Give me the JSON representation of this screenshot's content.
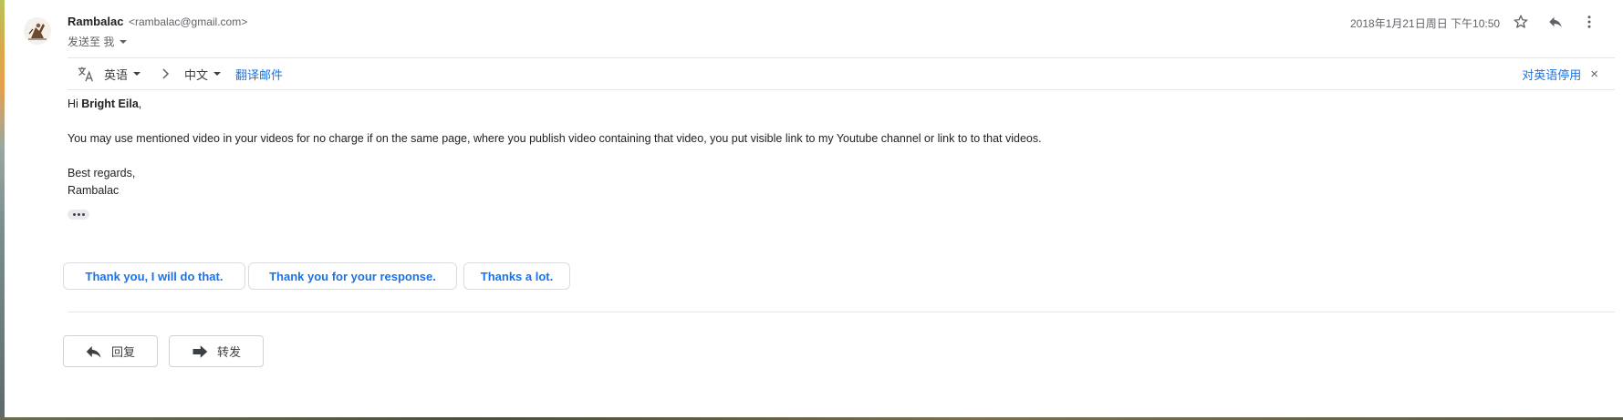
{
  "message": {
    "sender_name": "Rambalac",
    "sender_email": "<rambalac@gmail.com>",
    "to_label": "发送至 我",
    "date": "2018年1月21日周日 下午10:50"
  },
  "icons": {
    "star": "star-outline-icon",
    "reply": "reply-icon",
    "more": "more-vert-icon",
    "translate": "translate-icon",
    "chevron": "chevron-right-icon",
    "close": "close-icon",
    "forward": "forward-icon"
  },
  "translate_bar": {
    "source_lang": "英语",
    "target_lang": "中文",
    "translate_link": "翻译邮件",
    "disable_link": "对英语停用",
    "close_symbol": "×"
  },
  "body": {
    "greeting_prefix": "Hi ",
    "greeting_name": "Bright Eila",
    "greeting_suffix": ",",
    "paragraph": "You may use mentioned video in your videos for no charge if on the same page, where you publish video containing that video, you put visible link to my Youtube channel or link to to that videos.",
    "closing": "Best regards,",
    "signature": "Rambalac"
  },
  "smart_replies": [
    "Thank you, I will do that.",
    "Thank you for your response.",
    "Thanks a lot."
  ],
  "actions": {
    "reply_label": "回复",
    "forward_label": "转发"
  },
  "colors": {
    "link_blue": "#1a73e8",
    "muted_text": "#5f6368",
    "border": "#dadce0"
  }
}
